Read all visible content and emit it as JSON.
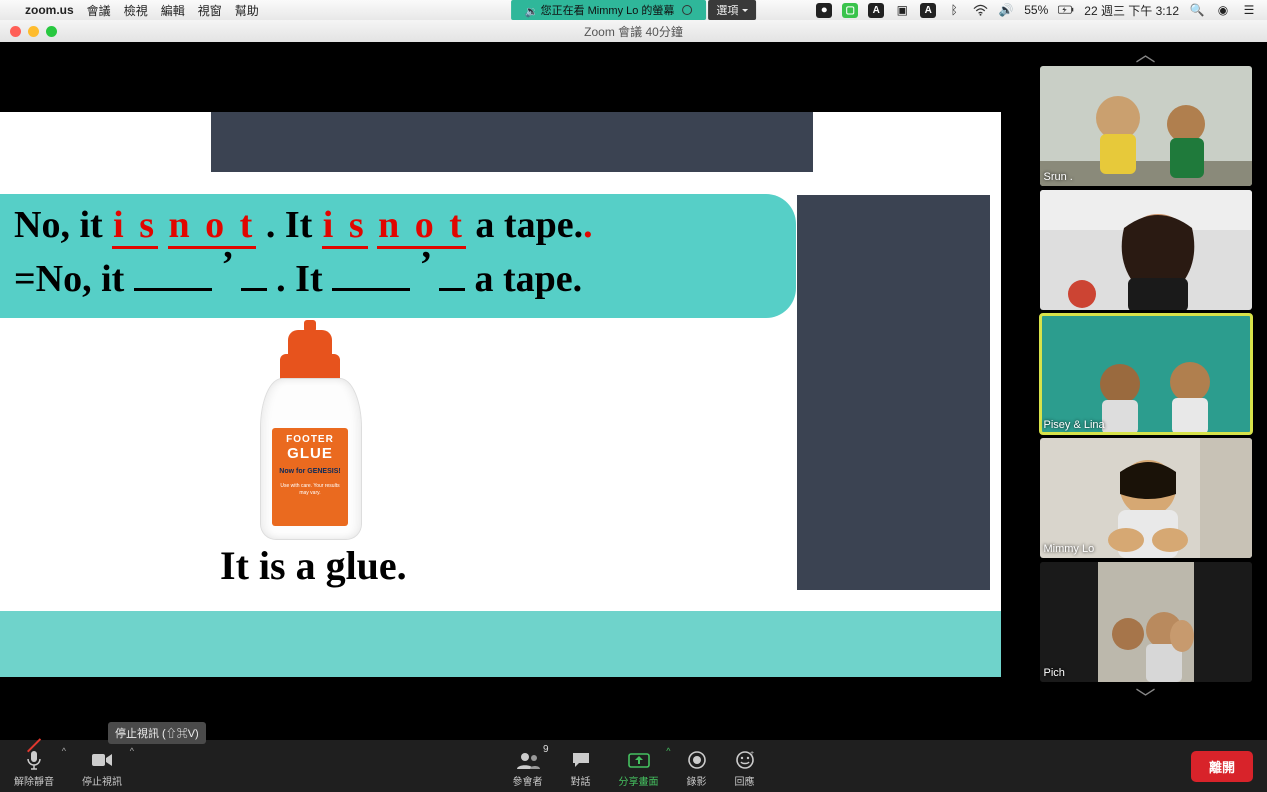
{
  "menubar": {
    "apple": "",
    "app": "zoom.us",
    "items": [
      "會議",
      "檢視",
      "編輯",
      "視窗",
      "幫助"
    ],
    "share_text": "您正在看 Mimmy Lo 的螢幕",
    "options": "選項",
    "battery": "55%",
    "date": "22 週三 下午 3:12"
  },
  "window": {
    "title": "Zoom 會議   40分鐘"
  },
  "slide": {
    "line1_a": "No, it ",
    "is": "i s",
    "not": "n o t",
    "line1_b": ". It ",
    "line1_c": " a tape",
    "line2_a": "=No, it ",
    "line2_b": ". It ",
    "line2_c": " a tape.",
    "glue_top": "FOOTER",
    "glue_main": "GLUE",
    "glue_now": "Now for GENESIS!",
    "glue_small": "Use with care. Your results may vary.",
    "caption": "It is a glue."
  },
  "participants": [
    {
      "name": "Srun ."
    },
    {
      "name": ""
    },
    {
      "name": "Pisey & Lina",
      "active": true
    },
    {
      "name": "Mimmy Lo"
    },
    {
      "name": "Pich"
    }
  ],
  "toolbar": {
    "unmute": "解除靜音",
    "stop_video": "停止視訊",
    "participants": "參會者",
    "participants_count": "9",
    "chat": "對話",
    "share": "分享畫面",
    "record": "錄影",
    "reactions": "回應",
    "leave": "離開",
    "tooltip": "停止視訊 (⇧⌘V)"
  }
}
